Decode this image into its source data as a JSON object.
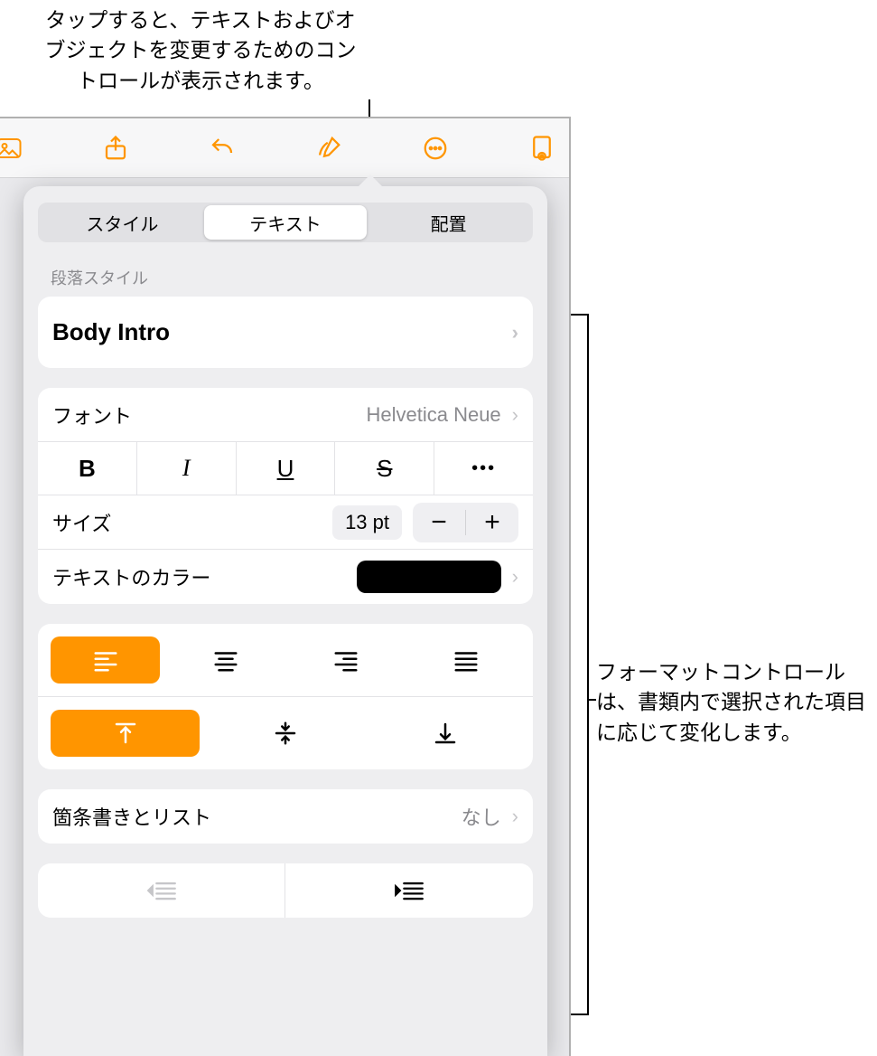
{
  "callouts": {
    "top": "タップすると、テキストおよびオブジェクトを変更するためのコントロールが表示されます。",
    "right": "フォーマットコントロールは、書類内で選択された項目に応じて変化します。"
  },
  "tabs": {
    "style": "スタイル",
    "text": "テキスト",
    "arrange": "配置"
  },
  "paragraph": {
    "section_label": "段落スタイル",
    "style_name": "Body Intro"
  },
  "font": {
    "label": "フォント",
    "value": "Helvetica Neue"
  },
  "size": {
    "label": "サイズ",
    "value": "13 pt"
  },
  "text_color": {
    "label": "テキストのカラー",
    "value": "#000000"
  },
  "bullets": {
    "label": "箇条書きとリスト",
    "value": "なし"
  },
  "style_buttons": {
    "bold": "B",
    "italic": "I",
    "underline": "U",
    "strike": "S",
    "more": "•••"
  },
  "stepper": {
    "minus": "−",
    "plus": "+"
  }
}
